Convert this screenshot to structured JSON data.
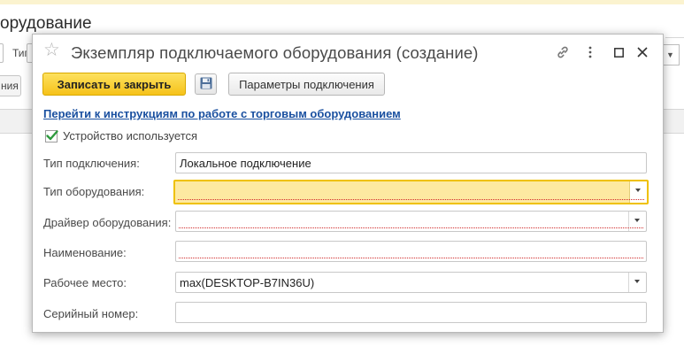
{
  "background": {
    "title_fragment": "орудование",
    "tip_label_fragment": "Тип",
    "button_fragment": "ния"
  },
  "dialog": {
    "title": "Экземпляр подключаемого оборудования (создание)",
    "icons": [
      "star-icon",
      "link-icon",
      "more-icon",
      "maximize-icon",
      "close-icon"
    ]
  },
  "toolbar": {
    "save_close_label": "Записать и закрыть",
    "save_icon": "floppy-disk-icon",
    "params_label": "Параметры подключения"
  },
  "link_text": "Перейти к инструкциям по работе с торговым оборудованием",
  "device_in_use": {
    "label": "Устройство используется",
    "checked": true
  },
  "fields": {
    "connection_type": {
      "label": "Тип подключения:",
      "value": "Локальное подключение"
    },
    "equipment_type": {
      "label": "Тип оборудования:",
      "value": ""
    },
    "driver": {
      "label": "Драйвер оборудования:",
      "value": ""
    },
    "name": {
      "label": "Наименование:",
      "value": ""
    },
    "workplace": {
      "label": "Рабочее место:",
      "value": "max(DESKTOP-B7IN36U)"
    },
    "serial": {
      "label": "Серийный номер:",
      "value": ""
    }
  },
  "colors": {
    "primary_button": "#f6c21a",
    "focused_field": "#fde9a1",
    "link": "#1a50a0",
    "checkmark": "#2e9a3e",
    "required_underline": "#d12b2b"
  }
}
